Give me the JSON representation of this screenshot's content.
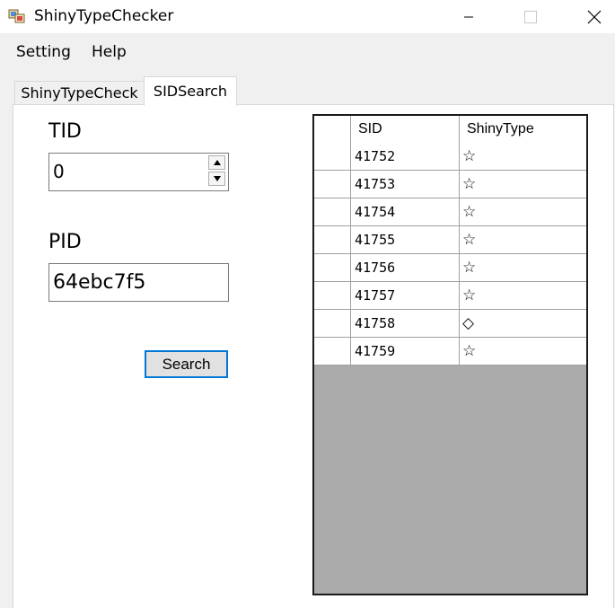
{
  "window": {
    "title": "ShinyTypeChecker",
    "minimize_icon": "minimize-icon",
    "maximize_icon": "maximize-icon",
    "close_icon": "close-icon"
  },
  "menu": {
    "items": [
      "Setting",
      "Help"
    ]
  },
  "tabs": [
    {
      "label": "ShinyTypeCheck",
      "active": false
    },
    {
      "label": "SIDSearch",
      "active": true
    }
  ],
  "form": {
    "tid_label": "TID",
    "tid_value": "0",
    "pid_label": "PID",
    "pid_value": "64ebc7f5",
    "search_label": "Search"
  },
  "results": {
    "columns": [
      "SID",
      "ShinyType"
    ],
    "rows": [
      {
        "sid": "41752",
        "type": "☆"
      },
      {
        "sid": "41753",
        "type": "☆"
      },
      {
        "sid": "41754",
        "type": "☆"
      },
      {
        "sid": "41755",
        "type": "☆"
      },
      {
        "sid": "41756",
        "type": "☆"
      },
      {
        "sid": "41757",
        "type": "☆"
      },
      {
        "sid": "41758",
        "type": "◇"
      },
      {
        "sid": "41759",
        "type": "☆"
      }
    ]
  },
  "colors": {
    "accent": "#0078d7",
    "grid_empty": "#ababab"
  }
}
